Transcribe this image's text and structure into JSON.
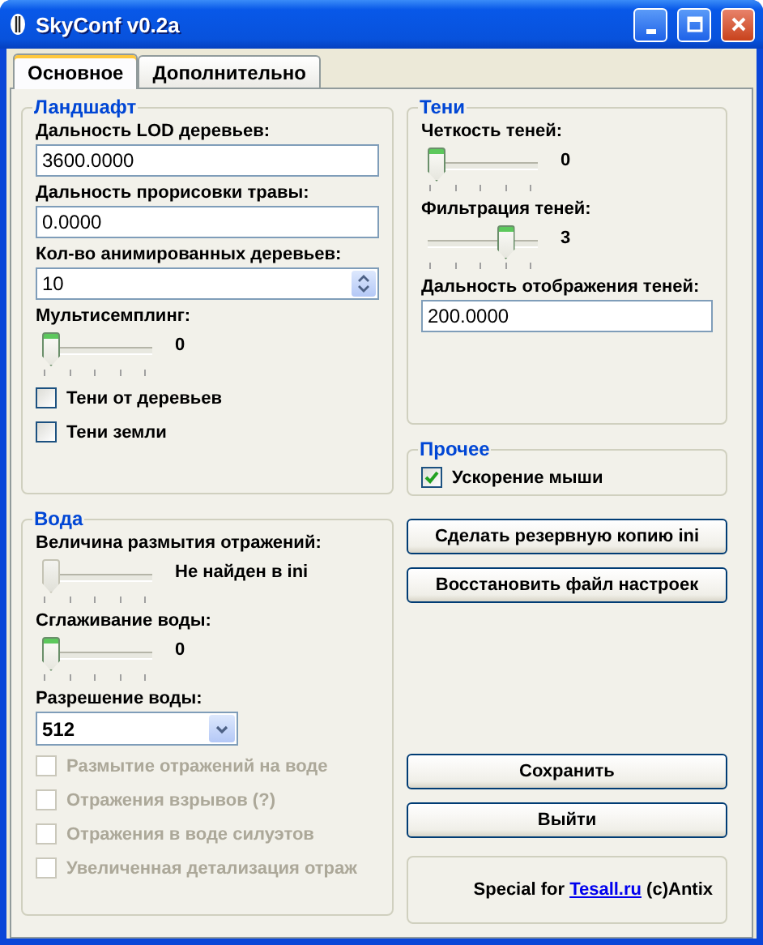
{
  "window": {
    "title": "SkyConf v0.2a"
  },
  "tabs": [
    {
      "label": "Основное",
      "selected": true
    },
    {
      "label": "Дополнительно",
      "selected": false
    }
  ],
  "left_groups": [
    {
      "title": "Ландшафт",
      "controls": [
        {
          "kind": "text",
          "label": "Дальность LOD деревьев:",
          "value": "3600.0000"
        },
        {
          "kind": "text",
          "label": "Дальность прорисовки травы:",
          "value": "0.0000"
        },
        {
          "kind": "spin",
          "label": "Кол-во анимированных деревьев:",
          "value": "10"
        },
        {
          "kind": "slider",
          "label": "Мультисемплинг:",
          "level": 0,
          "reading": "0",
          "disabled": false
        },
        {
          "kind": "checkbox",
          "label": "Тени от деревьев",
          "checked": false,
          "disabled": false
        },
        {
          "kind": "checkbox",
          "label": "Тени земли",
          "checked": false,
          "disabled": false
        }
      ]
    },
    {
      "title": "Вода",
      "controls": [
        {
          "kind": "slider",
          "label": "Величина размытия отражений:",
          "level": 0,
          "reading": "Не найден в ini",
          "disabled": true
        },
        {
          "kind": "slider",
          "label": "Сглаживание воды:",
          "level": 0,
          "reading": "0",
          "disabled": false
        },
        {
          "kind": "select",
          "label": "Разрешение воды:",
          "value": "512"
        },
        {
          "kind": "checkbox",
          "label": "Размытие отражений на воде",
          "checked": false,
          "disabled": true
        },
        {
          "kind": "checkbox",
          "label": "Отражения взрывов (?)",
          "checked": false,
          "disabled": true
        },
        {
          "kind": "checkbox",
          "label": "Отражения в воде силуэтов",
          "checked": false,
          "disabled": true
        },
        {
          "kind": "checkbox",
          "label": "Увеличенная детализация отраж",
          "checked": false,
          "disabled": true
        }
      ]
    }
  ],
  "right_groups": [
    {
      "title": "Тени",
      "controls": [
        {
          "kind": "slider",
          "label": "Четкость теней:",
          "level": 0,
          "reading": "0",
          "disabled": false
        },
        {
          "kind": "slider",
          "label": "Фильтрация теней:",
          "level": 0.75,
          "reading": "3",
          "disabled": false
        },
        {
          "kind": "text",
          "label": "Дальность отображения теней:",
          "value": "200.0000"
        }
      ]
    },
    {
      "title": "Прочее",
      "controls": [
        {
          "kind": "checkbox",
          "label": "Ускорение мыши",
          "checked": true,
          "disabled": false
        }
      ]
    }
  ],
  "ini_buttons": [
    "Сделать резервную копию ini",
    "Восстановить файл настроек"
  ],
  "action_buttons": [
    "Сохранить",
    "Выйти"
  ],
  "credits": {
    "before": "Special for ",
    "link": "Tesall.ru",
    "after": " (c)Antix"
  }
}
